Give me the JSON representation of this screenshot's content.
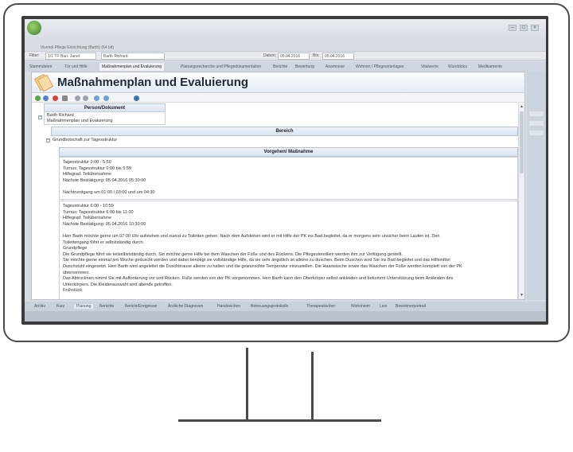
{
  "app": {
    "window_title": "Vivendi Pflege Einrichtung (Barth) (64 bit)",
    "top_bar": {
      "filter_label": "Filter:",
      "filter_value": "1/1 TP Barr. Janet",
      "client_value": "Barth Richard",
      "date_label": "Datum:",
      "date_from": "05.04.2016",
      "bis_label": "Bis:",
      "date_to": "05.04.2016"
    },
    "tabs": [
      "Stammdaten",
      "Tür und Hilfe",
      "Maßnahmenplan und Evaluierung",
      "Planungsrecherche und Pflegedokumentation",
      "Berichte",
      "Bewertung",
      "Anamnese",
      "Wohnen / Pflegeunterlagen",
      "Vitalwerte",
      "Wunddoku",
      "Medikamente"
    ],
    "active_tab_index": 2
  },
  "panel": {
    "title": "Maßnahmenplan und Evaluierung",
    "toolbar_icons": [
      "add-icon",
      "edit-icon",
      "delete-icon",
      "print-icon",
      "back-icon",
      "forward-icon",
      "expand-icon",
      "collapse-icon",
      "help-icon"
    ]
  },
  "document": {
    "person_header": "Person/Dokument",
    "person_name": "Barth Richard",
    "document_name": "Maßnahmenplan und Evaluierung",
    "bereich_header": "Bereich",
    "bereich_item": "Grundbotschaft zur Tagesstruktur",
    "vorgehen_header": "Vorgehen/ Maßnahme",
    "block1": [
      "Tagesstruktur 0:00 - 5:59",
      "Turnus: Tagesstruktur 0:00 bis 5:59",
      "Hilfegrad:  Teilübernahme",
      "Nächste Bestätigung: 05.04.2016 05:30:00",
      "",
      "Nachtrundgang um 01:00 / 03:00 und um 04:30"
    ],
    "block2": [
      "Tagesstruktur 6:00 - 10:59",
      "Turnus: Tagesstruktur 6:00 bis 11:00",
      "Hilfegrad:  Teilübernahme",
      "Nächste Bestätigung: 05.04.2016 10:30:00",
      "",
      "Herr Barth möchte gerne um 07:00 Uhr aufstehen und zuerst zu Toiletten gehen. Nach dem Aufstehen wird er mit Hilfe der PK ins Bad begleitet, da er morgens sehr unsicher beim Laufen ist. Den",
      "Toilettengang führt er selbstständig durch.",
      "Grundpflege",
      "Die Grundpflege führt sie teilselbstständig durch. Sie möchte gerne Hilfe bei dem Waschen der Füße und des Rückens. Die Pflegeutensilien werden ihm zur Verfügung gestellt.",
      "Sie möchte gerne einmal pro Woche geduscht werden und dabei benötigt sie vollständige Hilfe, da sie sehr ängstlich ist alleine zu duschen. Beim Duschen wird Sie ins Bad begleitet und das Hilfsmittel",
      "Duschstuhl eingesetzt. Herr Barth wird angeleitet die Duschbrause alleine zu halten und die gewünschte Temperatur einzustellen. Die Haarwäsche sowie das Waschen der Füße werden komplett von der PK",
      "übernommen.",
      "Das Abtrocknen nimmt Sie mit Aufforderung vor und Rücken. Füße werden von der PK vorgenommen. Herr Barth kann den Oberkörper selbst ankleiden und bekommt Unterstützung beim Ankleiden des",
      "Unterkörpers. Die Kleiderauswahl wird abends getroffen.",
      "Frühstück"
    ]
  },
  "status_tabs": [
    "Archiv",
    "Kurz",
    "Planung",
    "Berichte",
    "Bericht/Ereignisse",
    "Ärztliche Diagnosen",
    "Handzeichen",
    "Betreuungsprotokolle",
    "Therapeutischer",
    "Wohnheim",
    "Leis",
    "Bewohnerportrait"
  ],
  "accent_color": "#d5e2f0"
}
